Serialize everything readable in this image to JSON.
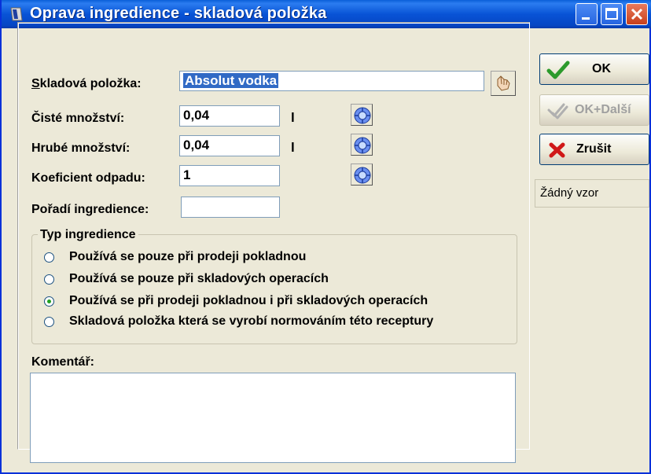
{
  "window": {
    "title": "Oprava ingredience - skladová položka"
  },
  "form": {
    "skladova_polozka": {
      "label": "Skladová položka:",
      "value": "Absolut vodka"
    },
    "ciste_mnozstvi": {
      "label": "Čisté množství:",
      "value": "0,04",
      "unit": "l"
    },
    "hrube_mnozstvi": {
      "label": "Hrubé množství:",
      "value": "0,04",
      "unit": "l"
    },
    "koeficient_odpadu": {
      "label": "Koeficient odpadu:",
      "value": "1"
    },
    "poradi_ingredience": {
      "label": "Pořadí ingredience:",
      "value": ""
    }
  },
  "typ_ingredience": {
    "title": "Typ ingredience",
    "options": [
      {
        "label": "Používá se pouze při prodeji pokladnou",
        "checked": false
      },
      {
        "label": "Používá se pouze při skladových operacích",
        "checked": false
      },
      {
        "label": "Používá se při prodeji pokladnou i při skladových operacích",
        "checked": true
      },
      {
        "label": "Skladová položka která se vyrobí normováním této receptury",
        "checked": false
      }
    ]
  },
  "komentar": {
    "label": "Komentář:",
    "value": ""
  },
  "buttons": {
    "ok": "OK",
    "ok_dalsi": "OK+Další",
    "zrusit": "Zrušit",
    "zadny_vzor": "Žádný vzor"
  },
  "colors": {
    "titlebar": "#0853d6",
    "dialog_bg": "#ece9d8",
    "selection": "#316ac5",
    "ok_check": "#2c9a2c",
    "cancel_x": "#d01818"
  }
}
